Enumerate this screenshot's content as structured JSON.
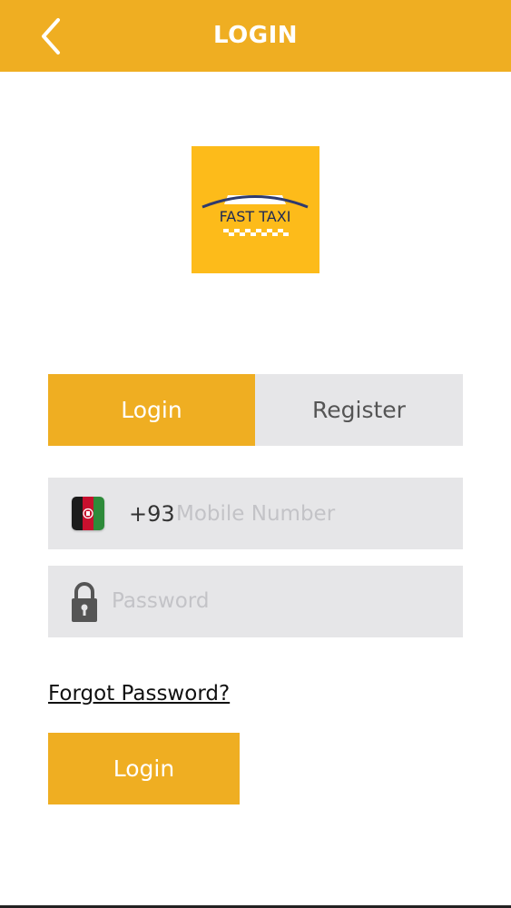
{
  "header": {
    "title": "LOGIN",
    "back_icon": "chevron-left-icon",
    "bg_color": "#EFAE22"
  },
  "logo": {
    "text": "FAST TAXI",
    "bg_color": "#FDBB1A"
  },
  "tabs": [
    {
      "label": "Login",
      "active": true
    },
    {
      "label": "Register",
      "active": false
    }
  ],
  "mobile": {
    "country_code": "+93",
    "placeholder": "Mobile Number",
    "value": "",
    "flag_icon": "afghanistan-flag-icon"
  },
  "password": {
    "placeholder": "Password",
    "value": "",
    "icon": "lock-icon"
  },
  "forgot_label": "Forgot Password?",
  "login_button_label": "Login",
  "colors": {
    "accent": "#EFAE22",
    "field_bg": "#E6E6E8",
    "placeholder": "#C3C3C7"
  }
}
